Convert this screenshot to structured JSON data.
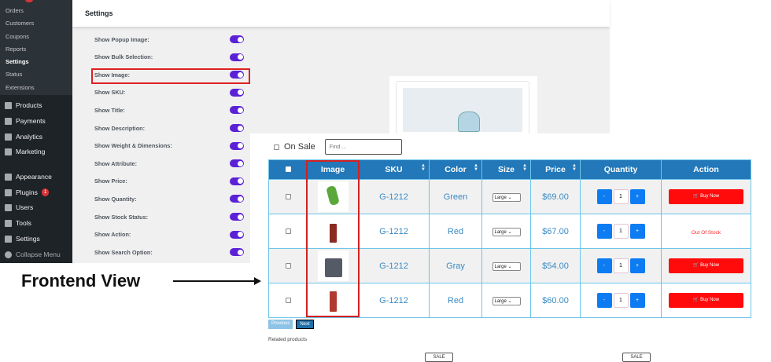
{
  "sidebar": {
    "submenu": [
      "Orders",
      "Customers",
      "Coupons",
      "Reports",
      "Settings",
      "Status",
      "Extensions"
    ],
    "active": "Settings",
    "menu": [
      {
        "label": "Products",
        "icon": "archive-icon"
      },
      {
        "label": "Payments",
        "icon": "dollar-icon"
      },
      {
        "label": "Analytics",
        "icon": "bar-chart-icon"
      },
      {
        "label": "Marketing",
        "icon": "megaphone-icon"
      },
      {
        "label": "Appearance",
        "icon": "brush-icon"
      },
      {
        "label": "Plugins",
        "icon": "plug-icon",
        "badge": "1"
      },
      {
        "label": "Users",
        "icon": "user-icon"
      },
      {
        "label": "Tools",
        "icon": "wrench-icon"
      },
      {
        "label": "Settings",
        "icon": "settings-icon"
      },
      {
        "label": "Collapse Menu",
        "icon": "collapse-icon"
      }
    ]
  },
  "settings": {
    "title": "Settings",
    "options": [
      "Show Popup Image:",
      "Show Bulk Selection:",
      "Show Image:",
      "Show SKU:",
      "Show Title:",
      "Show Description:",
      "Show Weight & Dimensions:",
      "Show Attribute:",
      "Show Price:",
      "Show Quantity:",
      "Show Stock Status:",
      "Show Action:",
      "Show Search Option:"
    ],
    "all_enabled": true,
    "toggle_color": "#5b21d6"
  },
  "frontend": {
    "on_sale": "On Sale",
    "find_placeholder": "Find....",
    "headers": [
      "Image",
      "SKU",
      "Color",
      "Size",
      "Price",
      "Quantity",
      "Action"
    ],
    "rows": [
      {
        "sku": "G-1212",
        "color": "Green",
        "size": "Large",
        "price": "$69.00",
        "qty": "1",
        "action": "Buy Now",
        "in_stock": true
      },
      {
        "sku": "G-1212",
        "color": "Red",
        "size": "Large",
        "price": "$67.00",
        "qty": "1",
        "action": "Out Of Stock",
        "in_stock": false
      },
      {
        "sku": "G-1212",
        "color": "Gray",
        "size": "Large",
        "price": "$54.00",
        "qty": "1",
        "action": "Buy Now",
        "in_stock": true
      },
      {
        "sku": "G-1212",
        "color": "Red",
        "size": "Large",
        "price": "$60.00",
        "qty": "1",
        "action": "Buy Now",
        "in_stock": true
      }
    ],
    "minus": "-",
    "plus": "+",
    "previous": "Previous",
    "next": "Next",
    "related": "Related products",
    "sale": "SALE"
  },
  "annotation": "Frontend View"
}
